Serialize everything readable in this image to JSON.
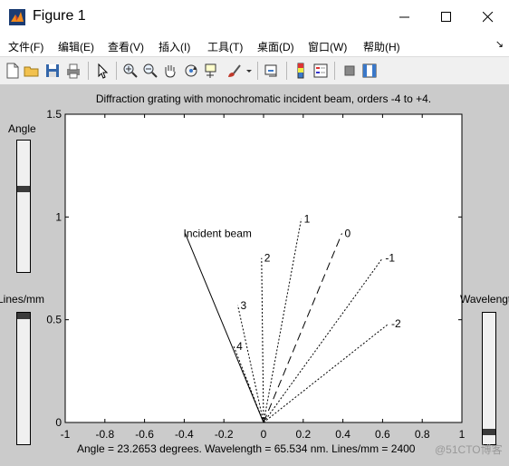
{
  "window": {
    "title": "Figure 1"
  },
  "menu": [
    {
      "label": "文件(F)"
    },
    {
      "label": "编辑(E)"
    },
    {
      "label": "查看(V)"
    },
    {
      "label": "插入(I)"
    },
    {
      "label": "工具(T)"
    },
    {
      "label": "桌面(D)"
    },
    {
      "label": "窗口(W)"
    },
    {
      "label": "帮助(H)"
    }
  ],
  "toolbar": {
    "icons": [
      "new-figure-icon",
      "open-file-icon",
      "save-icon",
      "print-icon",
      "pointer-icon",
      "zoom-in-icon",
      "zoom-out-icon",
      "pan-hand-icon",
      "rotate-3d-icon",
      "data-cursor-icon",
      "brush-icon",
      "link-plot-icon",
      "colorbar-icon",
      "legend-icon",
      "hide-plot-tools-icon",
      "show-plot-tools-icon"
    ]
  },
  "controls": {
    "angle_label": "Angle",
    "angle_level": 0.64,
    "lines_label": "Lines/mm",
    "lines_level": 1.0,
    "wavelength_label": "Wavelength",
    "wavelength_level": 0.07,
    "status_text": "Angle = 23.2653 degrees.   Wavelength = 65.534 nm. Lines/mm = 2400",
    "watermark": "@51CTO博客"
  },
  "chart_data": {
    "type": "line",
    "title": "Diffraction grating with monochromatic incident beam, orders -4 to +4.",
    "xlim": [
      -1,
      1
    ],
    "ylim": [
      0,
      1.5
    ],
    "x_ticks": [
      "-1",
      "-0.8",
      "-0.6",
      "-0.4",
      "-0.2",
      "0",
      "0.2",
      "0.4",
      "0.6",
      "0.8",
      "1"
    ],
    "y_ticks": [
      "0",
      "0.5",
      "1",
      "1.5"
    ],
    "grid": false,
    "incident": {
      "label": "Incident beam",
      "x": -0.395,
      "y": 0.92
    },
    "orders": [
      {
        "label": "4",
        "x": -0.15,
        "y": 0.37,
        "style": "dotted"
      },
      {
        "label": "3",
        "x": -0.13,
        "y": 0.57,
        "style": "dotted"
      },
      {
        "label": "2",
        "x": -0.01,
        "y": 0.8,
        "style": "dotted"
      },
      {
        "label": "1",
        "x": 0.19,
        "y": 0.99,
        "style": "dotted"
      },
      {
        "label": "0",
        "x": 0.395,
        "y": 0.92,
        "style": "dashed"
      },
      {
        "label": "-1",
        "x": 0.6,
        "y": 0.8,
        "style": "dotted"
      },
      {
        "label": "-2",
        "x": 0.63,
        "y": 0.48,
        "style": "dotted"
      }
    ]
  }
}
